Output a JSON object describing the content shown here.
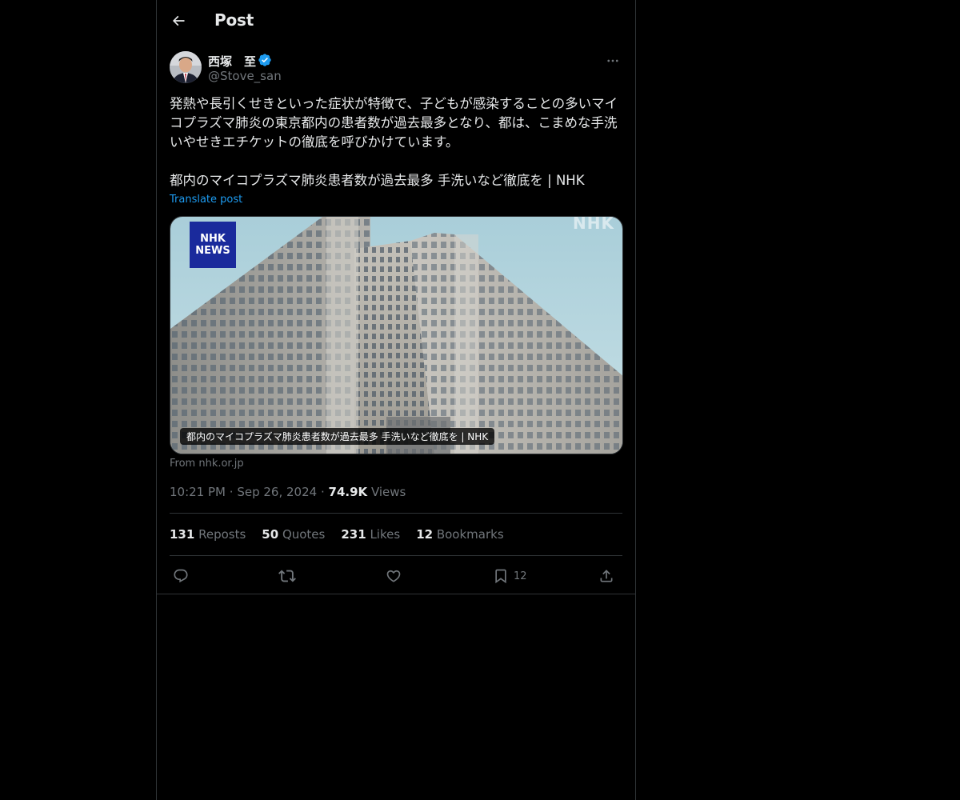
{
  "header": {
    "title": "Post"
  },
  "author": {
    "display_name": "西塚　至",
    "handle": "@Stove_san",
    "verified_color": "#1d9bf0"
  },
  "post": {
    "text": "発熱や長引くせきといった症状が特徴で、子どもが感染することの多いマイコプラズマ肺炎の東京都内の患者数が過去最多となり、都は、こまめな手洗いやせきエチケットの徹底を呼びかけています。\n\n都内のマイコプラズマ肺炎患者数が過去最多 手洗いなど徹底を | NHK",
    "translate_label": "Translate post"
  },
  "card": {
    "badge_line1": "NHK",
    "badge_line2": "NEWS",
    "watermark": "NHK",
    "caption": "都内のマイコプラズマ肺炎患者数が過去最多 手洗いなど徹底を | NHK",
    "source": "From nhk.or.jp"
  },
  "meta": {
    "time": "10:21 PM",
    "dot": "·",
    "date": "Sep 26, 2024",
    "views_count": "74.9K",
    "views_label": "Views"
  },
  "stats": [
    {
      "count": "131",
      "label": "Reposts"
    },
    {
      "count": "50",
      "label": "Quotes"
    },
    {
      "count": "231",
      "label": "Likes"
    },
    {
      "count": "12",
      "label": "Bookmarks"
    }
  ],
  "actions": {
    "reply_icon": "reply-icon",
    "repost_icon": "repost-icon",
    "like_icon": "like-icon",
    "bookmark_icon": "bookmark-icon",
    "bookmark_count": "12",
    "share_icon": "share-icon"
  }
}
